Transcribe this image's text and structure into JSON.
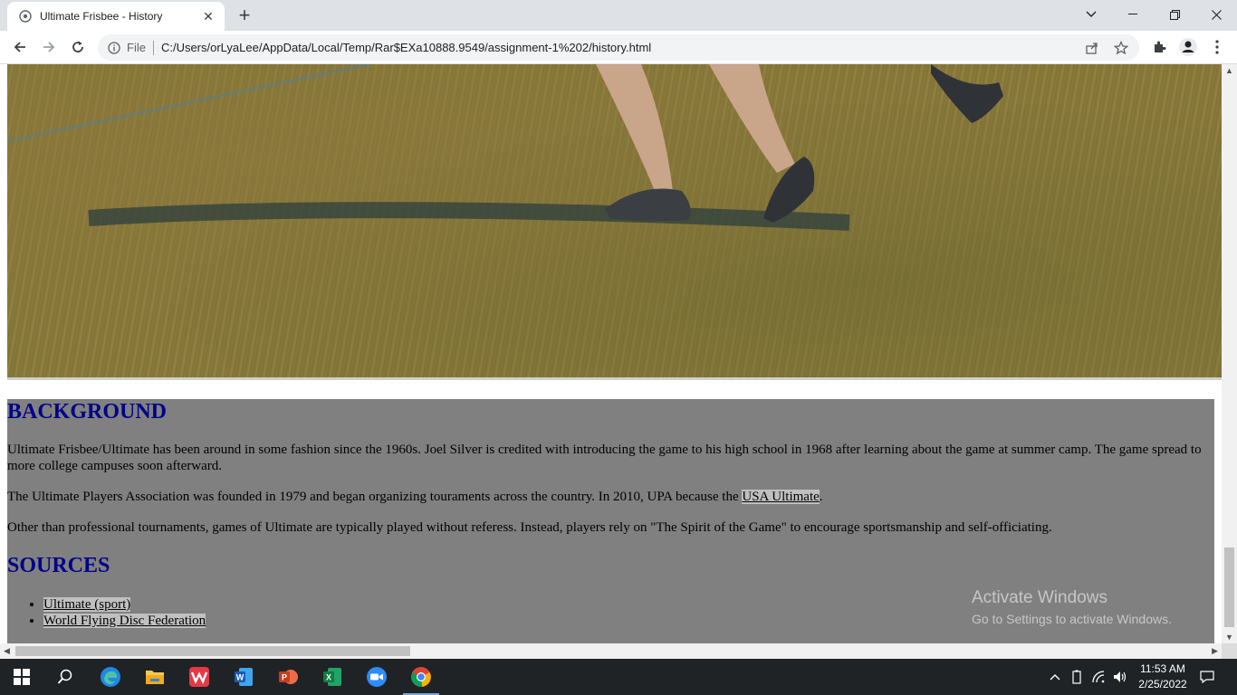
{
  "browser": {
    "tab_title": "Ultimate Frisbee - History",
    "address_scheme": "File",
    "address_url": "C:/Users/orLyaLee/AppData/Local/Temp/Rar$EXa10888.9549/assignment-1%202/history.html"
  },
  "page": {
    "background_heading": "BACKGROUND",
    "paragraph_1": "Ultimate Frisbee/Ultimate has been around in some fashion since the 1960s. Joel Silver is credited with introducing the game to his high school in 1968 after learning about the game at summer camp. The game spread to more college campuses soon afterward.",
    "paragraph_2_before": "The Ultimate Players Association was founded in 1979 and began organizing touraments across the country. In 2010, UPA because the ",
    "paragraph_2_link": "USA Ultimate",
    "paragraph_2_after": ".",
    "paragraph_3": "Other than professional tournaments, games of Ultimate are typically played without referess. Instead, players rely on \"The Spirit of the Game\" to encourage sportsmanship and self-officiating.",
    "sources_heading": "SOURCES",
    "sources": [
      "Ultimate (sport)",
      "World Flying Disc Federation"
    ]
  },
  "watermark": {
    "line1": "Activate Windows",
    "line2": "Go to Settings to activate Windows."
  },
  "taskbar": {
    "time": "11:53 AM",
    "date": "2/25/2022"
  },
  "colors": {
    "heading": "#00008b",
    "content_bg": "#808080",
    "link_bg": "#c0c0c0"
  }
}
